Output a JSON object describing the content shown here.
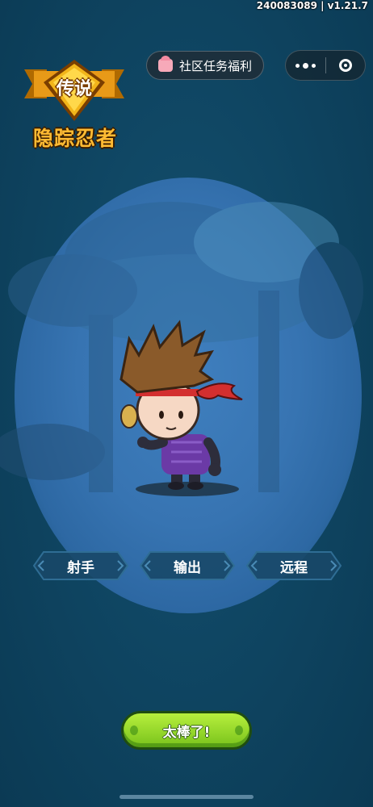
{
  "version": "240083089 | v1.21.7",
  "top_bar": {
    "community_button": "社区任务福利"
  },
  "hero": {
    "rarity": "传说",
    "name": "隐踪忍者"
  },
  "tags": [
    "射手",
    "输出",
    "远程"
  ],
  "confirm_button": "太棒了!",
  "colors": {
    "background": "#0f4663",
    "spotlight": "#3774b2",
    "name_gold": "#ffbb33",
    "button_green": "#8ad426"
  }
}
